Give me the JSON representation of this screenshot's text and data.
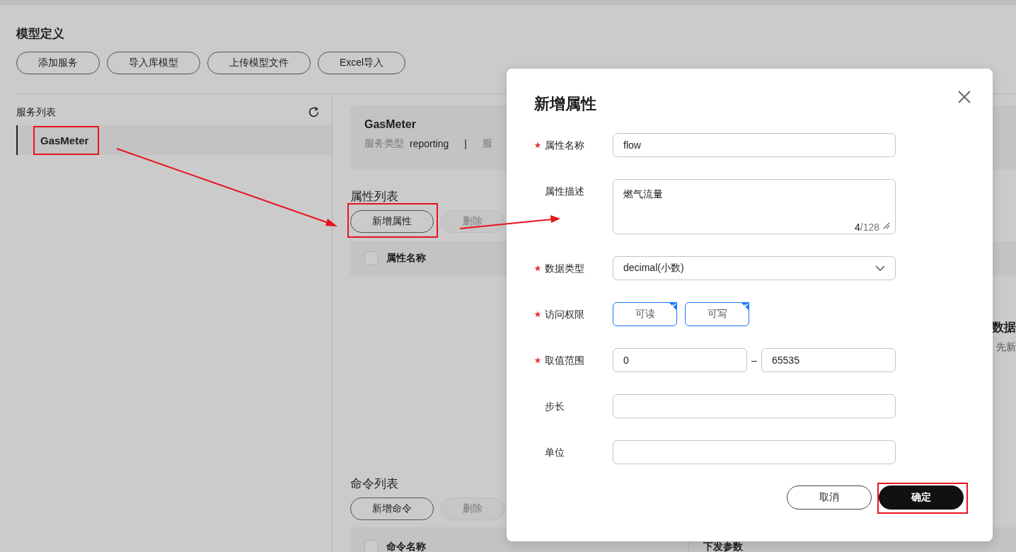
{
  "page": {
    "title": "模型定义",
    "toolbar": [
      "添加服务",
      "导入库模型",
      "上传模型文件",
      "Excel导入"
    ]
  },
  "service_list": {
    "title": "服务列表",
    "items": [
      {
        "label": "GasMeter",
        "selected": true,
        "highlighted": true
      }
    ]
  },
  "service_card": {
    "name": "GasMeter",
    "type_label": "服务类型",
    "type_value": "reporting",
    "separator": "|",
    "next_label": "服"
  },
  "property_list": {
    "title": "属性列表",
    "buttons": [
      {
        "label": "新增属性",
        "disabled": false,
        "highlighted": true
      },
      {
        "label": "删除",
        "disabled": true,
        "highlighted": false
      }
    ],
    "columns": [
      "属性名称"
    ],
    "select_all": false
  },
  "empty_state": {
    "title": "数据",
    "hint": "先新"
  },
  "command_list": {
    "title": "命令列表",
    "buttons": [
      {
        "label": "新增命令",
        "disabled": false,
        "highlighted": false
      },
      {
        "label": "删除",
        "disabled": true,
        "highlighted": false
      }
    ],
    "columns": [
      "命令名称",
      "下发参数"
    ],
    "select_all": false
  },
  "dialog": {
    "title": "新增属性",
    "fields": [
      {
        "kind": "text",
        "label": "属性名称",
        "required": true,
        "value": "flow"
      },
      {
        "kind": "textarea",
        "label": "属性描述",
        "required": false,
        "value": "燃气流量",
        "count": "4",
        "limit": "/128"
      },
      {
        "kind": "select",
        "label": "数据类型",
        "required": true,
        "value": "decimal(小数)"
      },
      {
        "kind": "checkgroup",
        "label": "访问权限",
        "required": true,
        "options": [
          {
            "label": "可读",
            "checked": true
          },
          {
            "label": "可写",
            "checked": true
          }
        ]
      },
      {
        "kind": "range",
        "label": "取值范围",
        "required": true,
        "min": "0",
        "separator": "–",
        "max": "65535"
      },
      {
        "kind": "text",
        "label": "步长",
        "required": false
      },
      {
        "kind": "text",
        "label": "单位",
        "required": false
      }
    ],
    "buttons": [
      {
        "label": "取消",
        "primary": false,
        "highlighted": false
      },
      {
        "label": "确定",
        "primary": true,
        "highlighted": true
      }
    ]
  }
}
